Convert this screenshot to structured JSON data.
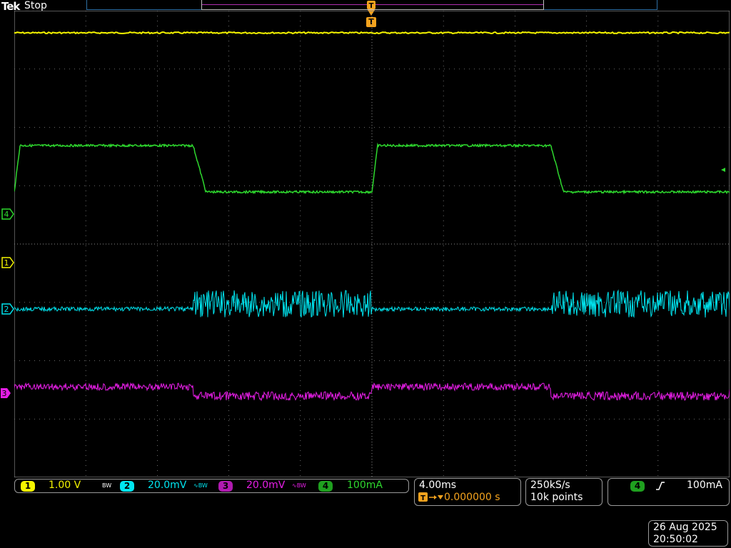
{
  "header": {
    "brand": "Tek",
    "run_state": "Stop",
    "trigger_marker": "T"
  },
  "colors": {
    "ch1": "#f5f500",
    "ch2": "#00e5f0",
    "ch3": "#e61ee6",
    "ch4": "#2ed82e",
    "trigger": "#f5a31e",
    "grid": "#8a8a8a"
  },
  "channels": [
    {
      "id": "1",
      "marker_label": "1",
      "scale": "1.00 V",
      "bw_icon": "BW"
    },
    {
      "id": "2",
      "marker_label": "2",
      "scale": "20.0mV",
      "bw_icon": "∿BW"
    },
    {
      "id": "3",
      "marker_label": "3",
      "scale": "20.0mV",
      "bw_icon": "∿BW"
    },
    {
      "id": "4",
      "marker_label": "4",
      "scale": "100mA"
    }
  ],
  "horizontal": {
    "scale": "4.00ms",
    "trigger_delay": "0.000000 s"
  },
  "acquisition": {
    "sample_rate": "250kS/s",
    "record_length": "10k points"
  },
  "trigger": {
    "source": "4",
    "slope_icon": "rising-edge-icon",
    "level": "100mA"
  },
  "timestamp": {
    "date": "26 Aug 2025",
    "time": "20:50:02"
  }
}
